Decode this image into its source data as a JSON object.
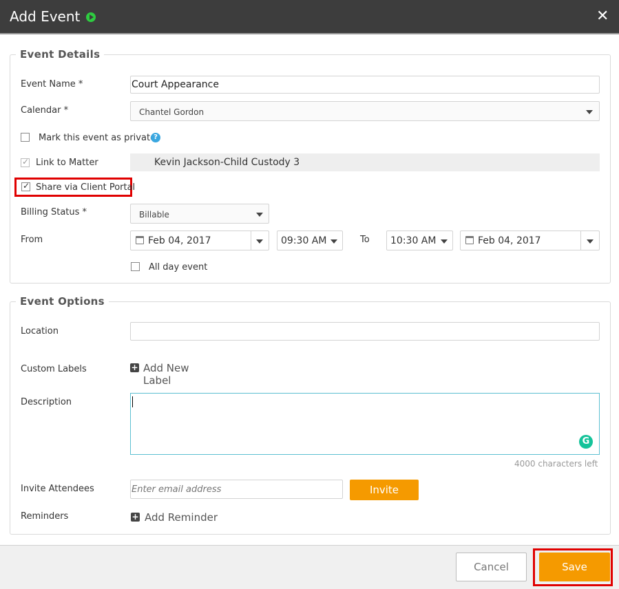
{
  "dialog": {
    "title": "Add Event"
  },
  "event_details": {
    "legend": "Event Details",
    "event_name_label": "Event Name *",
    "event_name_value": "Court Appearance",
    "calendar_label": "Calendar *",
    "calendar_value": "Chantel Gordon",
    "private_label": "Mark this event as private",
    "link_matter_label": "Link to Matter",
    "matter_value": "Kevin Jackson-Child Custody 3",
    "share_portal_label": "Share via Client Portal",
    "billing_label": "Billing Status *",
    "billing_value": "Billable",
    "from_label": "From",
    "from_date": "Feb 04, 2017",
    "from_time": "09:30 AM",
    "to_label": "To",
    "to_time": "10:30 AM",
    "to_date": "Feb 04, 2017",
    "all_day_label": "All day event"
  },
  "event_options": {
    "legend": "Event Options",
    "location_label": "Location",
    "custom_labels_label": "Custom Labels",
    "add_label": "Add New Label",
    "description_label": "Description",
    "chars_left": "4000 characters left",
    "invite_label": "Invite Attendees",
    "email_placeholder": "Enter email address",
    "invite_button": "Invite",
    "reminders_label": "Reminders",
    "add_reminder": "Add Reminder"
  },
  "footer": {
    "cancel": "Cancel",
    "save": "Save"
  },
  "colors": {
    "accent": "#f59a00",
    "titlebar": "#3d3d3d",
    "highlight": "#e00000"
  }
}
